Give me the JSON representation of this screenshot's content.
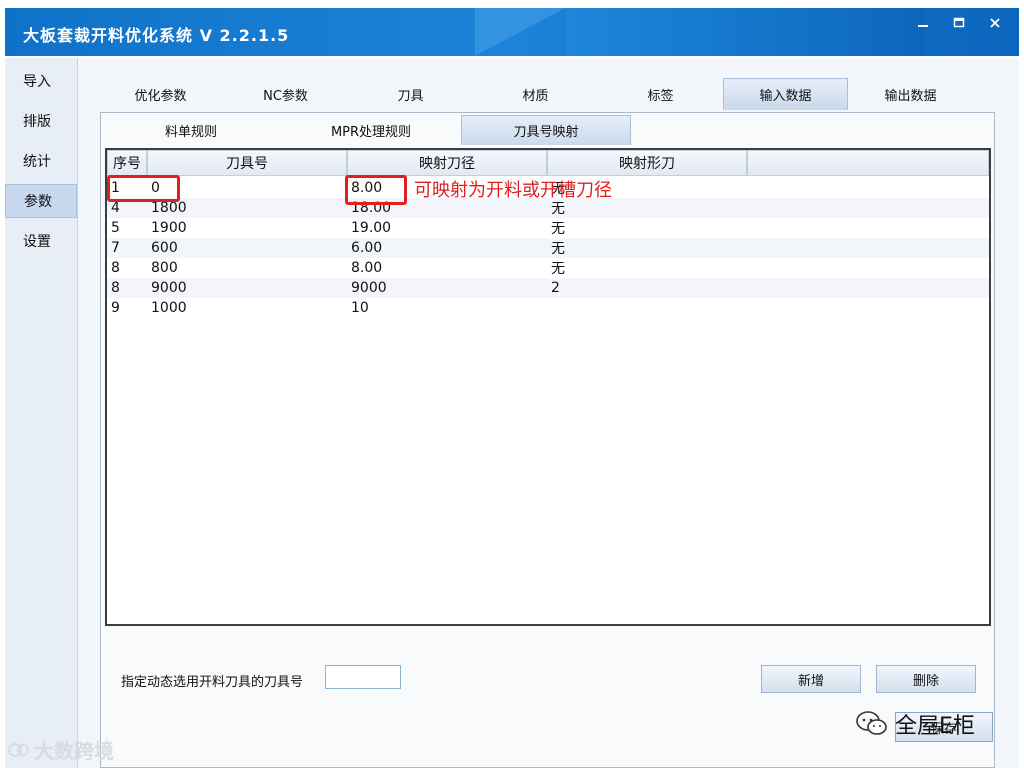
{
  "app": {
    "title": "大板套裁开料优化系统 V 2.2.1.5",
    "controls": {
      "minimize": "minimize-icon",
      "maximize": "maximize-icon",
      "close": "close-icon"
    }
  },
  "sidebar": {
    "items": [
      {
        "label": "导入"
      },
      {
        "label": "排版"
      },
      {
        "label": "统计"
      },
      {
        "label": "参数",
        "active": true
      },
      {
        "label": "设置"
      }
    ]
  },
  "top_tabs": [
    {
      "label": "优化参数"
    },
    {
      "label": "NC参数"
    },
    {
      "label": "刀具"
    },
    {
      "label": "材质"
    },
    {
      "label": "标签"
    },
    {
      "label": "输入数据",
      "active": true
    },
    {
      "label": "输出数据"
    }
  ],
  "sub_tabs": [
    {
      "label": "料单规则"
    },
    {
      "label": "MPR处理规则"
    },
    {
      "label": "刀具号映射",
      "active": true
    }
  ],
  "table": {
    "headers": [
      "序号",
      "刀具号",
      "映射刀径",
      "映射形刀"
    ],
    "rows": [
      [
        "1",
        "0",
        "8.00",
        "无"
      ],
      [
        "4",
        "1800",
        "18.00",
        "无"
      ],
      [
        "5",
        "1900",
        "19.00",
        "无"
      ],
      [
        "7",
        "600",
        "6.00",
        "无"
      ],
      [
        "8",
        "800",
        "8.00",
        "无"
      ],
      [
        "8",
        "9000",
        "9000",
        "2"
      ],
      [
        "9",
        "1000",
        "10",
        ""
      ]
    ]
  },
  "annotation": {
    "text": "可映射为开料或开槽刀径",
    "color": "#e02020"
  },
  "bottom": {
    "label": "指定动态选用开料刀具的刀具号",
    "input_value": "",
    "add_button": "新增",
    "delete_button": "删除"
  },
  "save_button": "保存",
  "watermarks": {
    "left": "大数跨境",
    "right": "全屋E柜"
  },
  "colors": {
    "titlebar": "#1679cf",
    "highlight": "#e02020"
  }
}
